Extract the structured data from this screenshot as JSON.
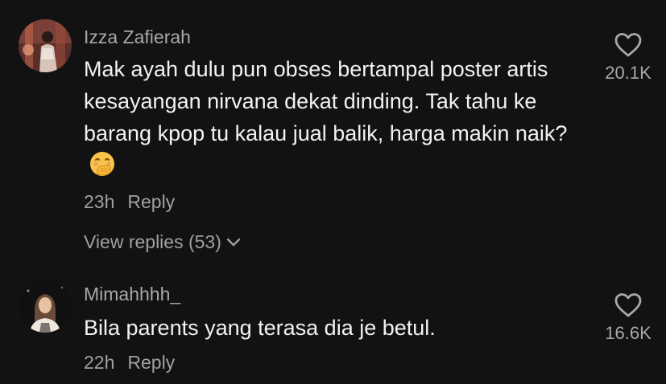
{
  "comments": [
    {
      "username": "Izza Zafierah",
      "text": "Mak ayah dulu pun obses bertampal poster artis kesayangan nirvana dekat dinding. Tak tahu ke barang kpop tu kalau jual balik, harga makin naik?",
      "emoji": "face-with-hand-over-mouth-emoji",
      "time": "23h",
      "reply_label": "Reply",
      "view_replies": "View replies (53)",
      "likes": "20.1K"
    },
    {
      "username": "Mimahhhh_",
      "text": "Bila parents yang terasa dia je betul.",
      "time": "22h",
      "reply_label": "Reply",
      "likes": "16.6K"
    }
  ]
}
